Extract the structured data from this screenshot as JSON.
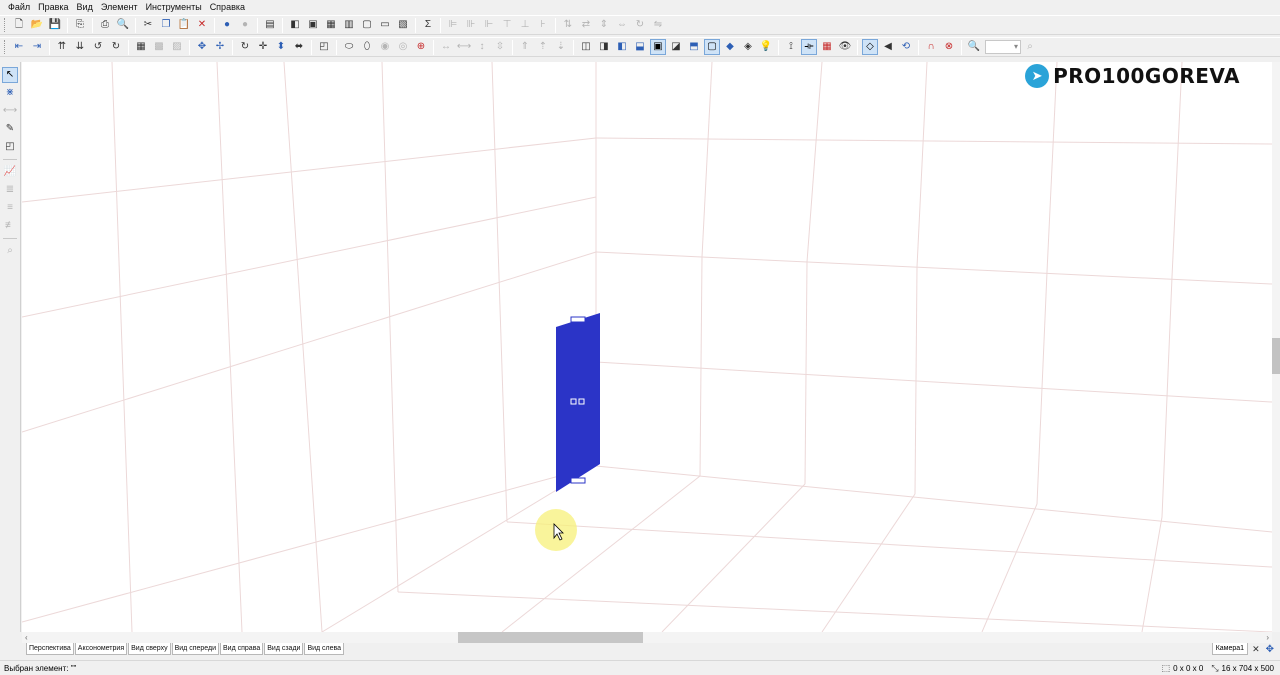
{
  "menu": [
    "Файл",
    "Правка",
    "Вид",
    "Элемент",
    "Инструменты",
    "Справка"
  ],
  "toolbar1": [
    {
      "icon": "new-file-icon",
      "g": "🗋",
      "cls": "dark"
    },
    {
      "icon": "open-folder-icon",
      "g": "📂",
      "cls": ""
    },
    {
      "icon": "save-icon",
      "g": "💾",
      "cls": "blue"
    },
    {
      "sep": true
    },
    {
      "icon": "export-icon",
      "g": "⎘",
      "cls": "dark"
    },
    {
      "sep": true
    },
    {
      "icon": "print-icon",
      "g": "⎙",
      "cls": "dark"
    },
    {
      "icon": "print-preview-icon",
      "g": "🔍",
      "cls": "dark"
    },
    {
      "sep": true
    },
    {
      "icon": "cut-icon",
      "g": "✂",
      "cls": "dark"
    },
    {
      "icon": "copy-icon",
      "g": "❐",
      "cls": "blue"
    },
    {
      "icon": "paste-icon",
      "g": "📋",
      "cls": "dis"
    },
    {
      "icon": "delete-icon",
      "g": "✕",
      "cls": "red"
    },
    {
      "sep": true
    },
    {
      "icon": "globe-icon",
      "g": "●",
      "cls": "blue"
    },
    {
      "icon": "materials-icon",
      "g": "●",
      "cls": "dis"
    },
    {
      "sep": true
    },
    {
      "icon": "properties-icon",
      "g": "▤",
      "cls": "dark"
    },
    {
      "sep": true
    },
    {
      "icon": "view-panel-icon",
      "g": "◧",
      "cls": "dark"
    },
    {
      "icon": "cabinet-icon",
      "g": "▣",
      "cls": "dark"
    },
    {
      "icon": "drawer-icon",
      "g": "▦",
      "cls": "dark"
    },
    {
      "icon": "panel-icon",
      "g": "▥",
      "cls": "dark"
    },
    {
      "icon": "door-icon",
      "g": "▢",
      "cls": "dark"
    },
    {
      "icon": "shelf-icon",
      "g": "▭",
      "cls": "dark"
    },
    {
      "icon": "group-icon",
      "g": "▧",
      "cls": "dark"
    },
    {
      "sep": true
    },
    {
      "icon": "sum-icon",
      "g": "Σ",
      "cls": "dark"
    },
    {
      "sep": true
    },
    {
      "icon": "align-left-icon",
      "g": "⊫",
      "cls": "dis"
    },
    {
      "icon": "align-center-icon",
      "g": "⊪",
      "cls": "dis"
    },
    {
      "icon": "align-right-icon",
      "g": "⊩",
      "cls": "dis"
    },
    {
      "icon": "align-top-icon",
      "g": "⊤",
      "cls": "dis"
    },
    {
      "icon": "align-middle-icon",
      "g": "⊥",
      "cls": "dis"
    },
    {
      "icon": "align-bottom-icon",
      "g": "⊦",
      "cls": "dis"
    },
    {
      "sep": true
    },
    {
      "icon": "distribute-icon",
      "g": "⇅",
      "cls": "dis"
    },
    {
      "icon": "distribute-h-icon",
      "g": "⇄",
      "cls": "dis"
    },
    {
      "icon": "size-icon",
      "g": "⇕",
      "cls": "dis"
    },
    {
      "icon": "size-h-icon",
      "g": "⇔",
      "cls": "dis"
    },
    {
      "icon": "rotate-icon",
      "g": "↻",
      "cls": "dis"
    },
    {
      "icon": "mirror-icon",
      "g": "⇋",
      "cls": "dis"
    }
  ],
  "toolbar2": [
    {
      "icon": "move-left-icon",
      "g": "⇤",
      "cls": "blue"
    },
    {
      "icon": "move-right-icon",
      "g": "⇥",
      "cls": "blue"
    },
    {
      "sep": true
    },
    {
      "icon": "lift-icon",
      "g": "⇈",
      "cls": "dark"
    },
    {
      "icon": "lower-icon",
      "g": "⇊",
      "cls": "dark"
    },
    {
      "icon": "rotate-left-icon",
      "g": "↺",
      "cls": "dark"
    },
    {
      "icon": "rotate-right-icon",
      "g": "↻",
      "cls": "dark"
    },
    {
      "sep": true
    },
    {
      "icon": "grid-icon",
      "g": "▦",
      "cls": "dark"
    },
    {
      "icon": "snap-grid-icon",
      "g": "▩",
      "cls": "dis"
    },
    {
      "icon": "snap-object-icon",
      "g": "▨",
      "cls": "dis"
    },
    {
      "sep": true
    },
    {
      "icon": "pivot-icon",
      "g": "✥",
      "cls": "blue"
    },
    {
      "icon": "pivot-point-icon",
      "g": "✢",
      "cls": "blue"
    },
    {
      "sep": true
    },
    {
      "icon": "rotate-tool-icon",
      "g": "↻",
      "cls": "dark"
    },
    {
      "icon": "move-tool-icon",
      "g": "✛",
      "cls": "dark"
    },
    {
      "icon": "scale-tool-icon",
      "g": "⬍",
      "cls": "blue"
    },
    {
      "icon": "stretch-tool-icon",
      "g": "⬌",
      "cls": "dark"
    },
    {
      "sep": true
    },
    {
      "icon": "contour-icon",
      "g": "◰",
      "cls": "dark"
    },
    {
      "sep": true
    },
    {
      "icon": "ellipse-icon",
      "g": "⬭",
      "cls": "dark"
    },
    {
      "icon": "ellipse2-icon",
      "g": "⬯",
      "cls": "dark"
    },
    {
      "icon": "show-icon",
      "g": "◉",
      "cls": "dis"
    },
    {
      "icon": "hide-icon",
      "g": "◎",
      "cls": "dis"
    },
    {
      "icon": "target-icon",
      "g": "⊕",
      "cls": "red"
    },
    {
      "sep": true
    },
    {
      "icon": "dim-h-icon",
      "g": "↔",
      "cls": "dis"
    },
    {
      "icon": "dim-h2-icon",
      "g": "⟷",
      "cls": "dis"
    },
    {
      "icon": "dim-v-icon",
      "g": "↕",
      "cls": "dis"
    },
    {
      "icon": "dim-v2-icon",
      "g": "⇳",
      "cls": "dis"
    },
    {
      "sep": true
    },
    {
      "icon": "arrow-up-icon",
      "g": "⇑",
      "cls": "dis"
    },
    {
      "icon": "arrow-up2-icon",
      "g": "⇡",
      "cls": "dis"
    },
    {
      "icon": "arrow-down-icon",
      "g": "⇣",
      "cls": "dis"
    },
    {
      "sep": true
    },
    {
      "icon": "view-front-icon",
      "g": "◫",
      "cls": "dark"
    },
    {
      "icon": "view-left-icon",
      "g": "◨",
      "cls": "dark"
    },
    {
      "icon": "view-right-icon",
      "g": "◧",
      "cls": "blue"
    },
    {
      "icon": "view-top-icon",
      "g": "⬓",
      "cls": "blue"
    },
    {
      "icon": "view-box-icon",
      "g": "▣",
      "cls": "on"
    },
    {
      "icon": "view-back-icon",
      "g": "◪",
      "cls": "dark"
    },
    {
      "icon": "view-iso-icon",
      "g": "⬒",
      "cls": "blue"
    },
    {
      "icon": "wire-icon",
      "g": "▢",
      "cls": "on"
    },
    {
      "icon": "shaded-icon",
      "g": "◆",
      "cls": "blue"
    },
    {
      "icon": "textured-icon",
      "g": "◈",
      "cls": "dark"
    },
    {
      "icon": "light-icon",
      "g": "💡",
      "cls": "dark"
    },
    {
      "sep": true
    },
    {
      "icon": "measure-icon",
      "g": "⟟",
      "cls": "dark"
    },
    {
      "icon": "dimensions-icon",
      "g": "⟛",
      "cls": "on"
    },
    {
      "icon": "table-grid-icon",
      "g": "▦",
      "cls": "red"
    },
    {
      "icon": "eye-icon",
      "g": "👁",
      "cls": "dark"
    },
    {
      "sep": true
    },
    {
      "icon": "select-diamond-icon",
      "g": "◇",
      "cls": "on"
    },
    {
      "icon": "speaker-icon",
      "g": "◀",
      "cls": "dark"
    },
    {
      "icon": "reset-view-icon",
      "g": "⟲",
      "cls": "blue"
    },
    {
      "sep": true
    },
    {
      "icon": "magnet-icon",
      "g": "∩",
      "cls": "red"
    },
    {
      "icon": "render-icon",
      "g": "⊗",
      "cls": "red"
    },
    {
      "sep": true
    },
    {
      "icon": "zoom-icon",
      "g": "🔍",
      "cls": "dis"
    },
    {
      "combo": true
    },
    {
      "icon": "zoom-fit-icon",
      "g": "⌕",
      "cls": "dis"
    }
  ],
  "vtoolbar": [
    {
      "icon": "select-arrow-icon",
      "g": "↖",
      "cls": "on"
    },
    {
      "icon": "multi-select-icon",
      "g": "⋇",
      "cls": "blue"
    },
    {
      "icon": "edit-dim-icon",
      "g": "⟷",
      "cls": "dis"
    },
    {
      "icon": "eyedropper-icon",
      "g": "✎",
      "cls": "dark"
    },
    {
      "icon": "contour-edit-icon",
      "g": "◰",
      "cls": "dark"
    },
    {
      "vsep": true
    },
    {
      "icon": "chart-icon",
      "g": "📈",
      "cls": "blue"
    },
    {
      "icon": "layer-icon",
      "g": "≣",
      "cls": "dis"
    },
    {
      "icon": "layer2-icon",
      "g": "≡",
      "cls": "dis"
    },
    {
      "icon": "layer3-icon",
      "g": "≢",
      "cls": "dis"
    },
    {
      "vsep": true
    },
    {
      "icon": "zoom-region-icon",
      "g": "⌕",
      "cls": "dis"
    }
  ],
  "logo_text": "PRO100GOREVA",
  "tabs": [
    "Перспектива",
    "Аксонометрия",
    "Вид сверху",
    "Вид спереди",
    "Вид справа",
    "Вид сзади",
    "Вид слева"
  ],
  "camera_tab": "Камера1",
  "status": {
    "selected": "Выбран элемент: \"\"",
    "pos": "0 x 0 x 0",
    "size": "16 x 704 x 500"
  },
  "colors": {
    "panel": "#2b34c7",
    "grid": "#e6cccc"
  }
}
